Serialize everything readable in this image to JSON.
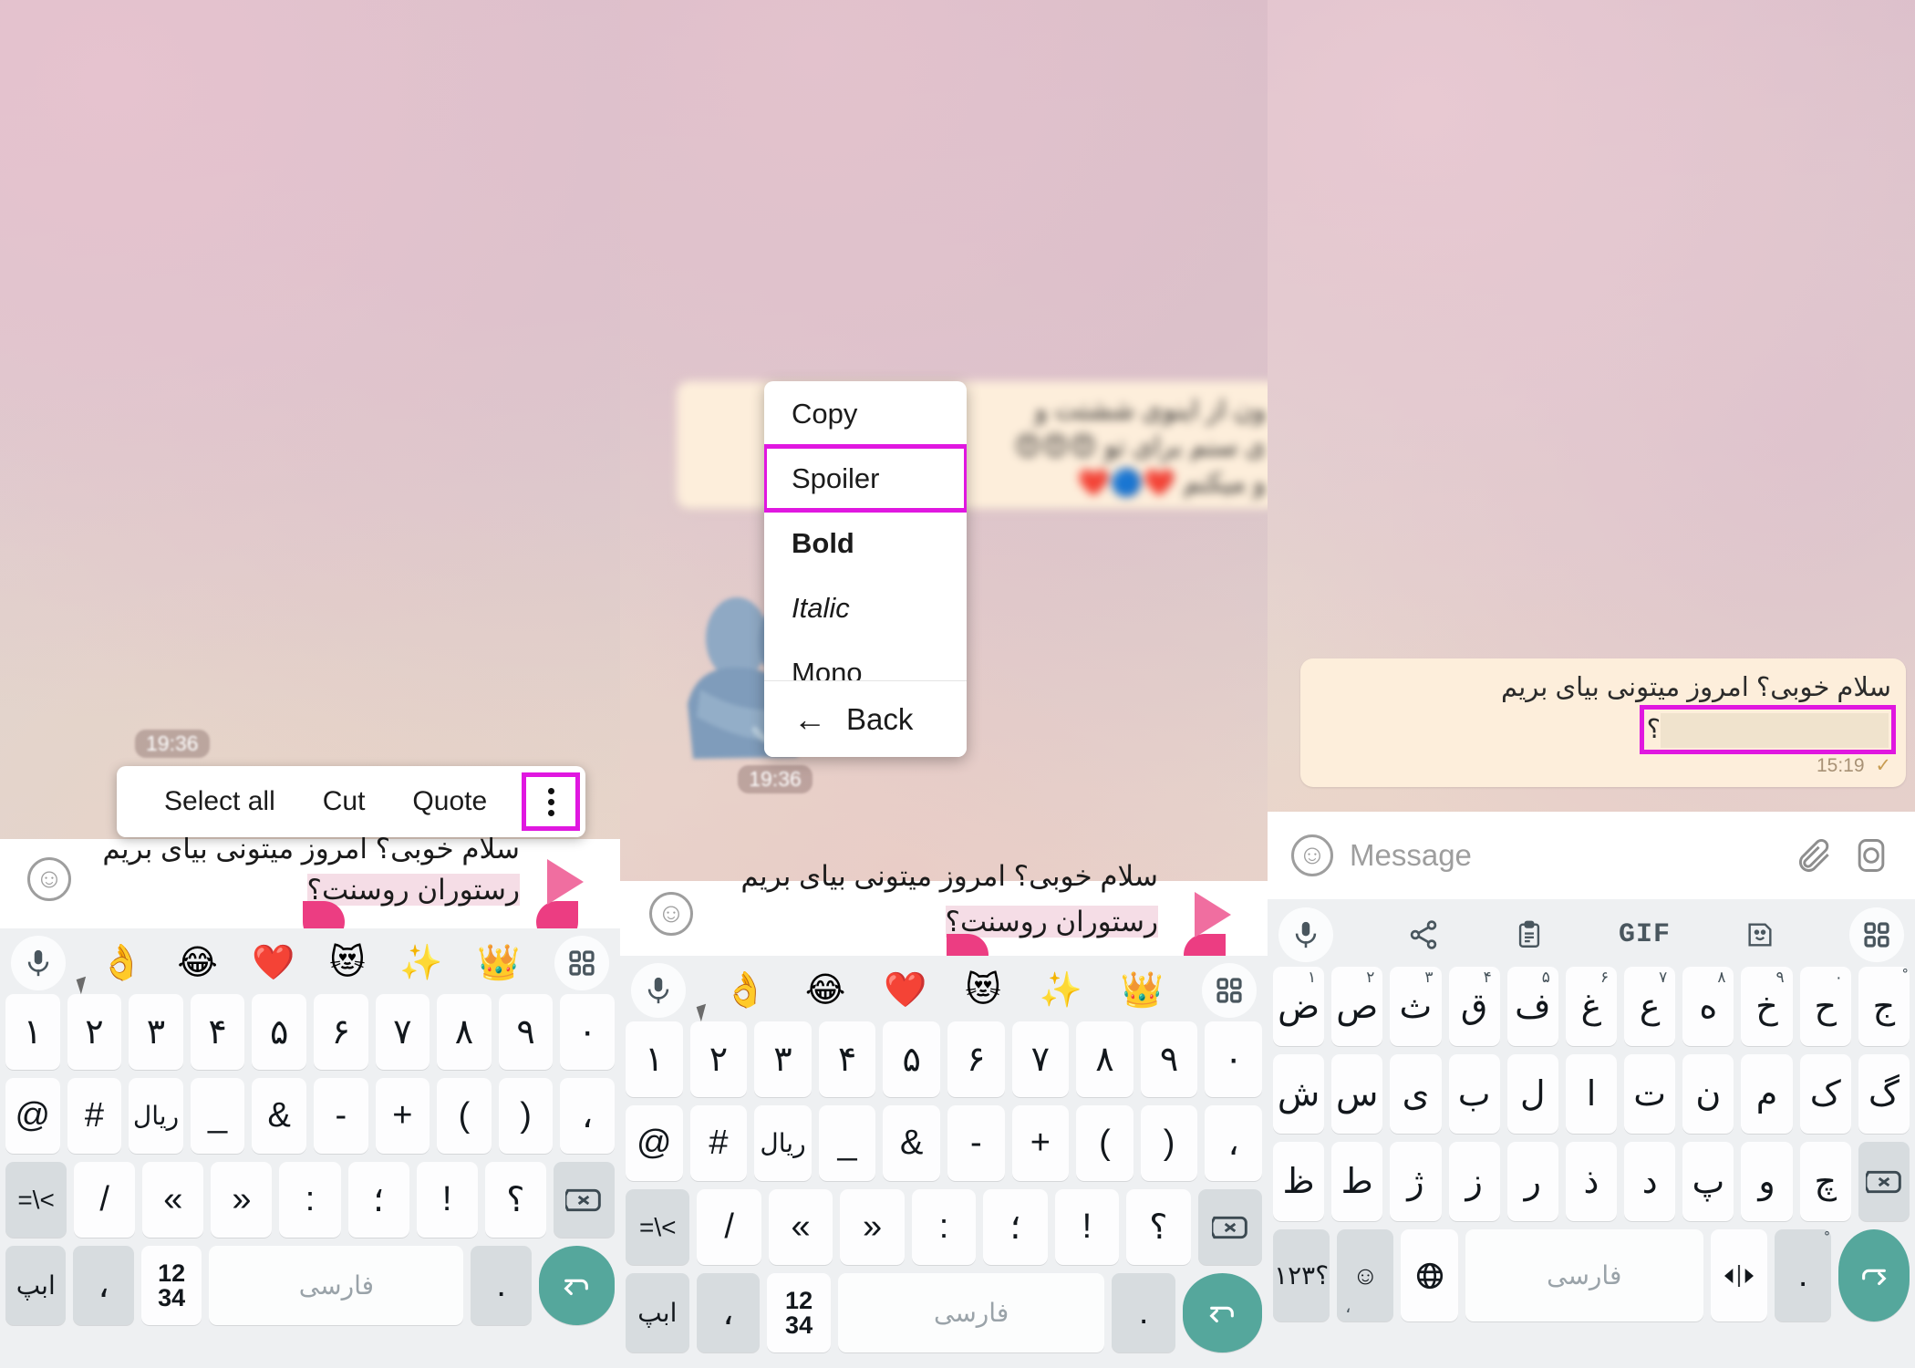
{
  "panels": {
    "left": {
      "timestamp": "19:36",
      "context_menu": {
        "items": [
          "Select all",
          "Cut",
          "Quote"
        ],
        "more_icon": "overflow-menu-icon"
      },
      "selected_message": {
        "line1": "سلام خوبی؟ امروز میتونی بیای بریم",
        "line2_plain": "رستوران روسنت؟",
        "highlighted": "رستوران روسنت؟"
      },
      "emoji_row": [
        "mic-icon",
        "👌",
        "😂",
        "❤️",
        "😻",
        "✨",
        "👑",
        "grid-icon"
      ],
      "keyboard": {
        "row1": [
          {
            "main": "۱"
          },
          {
            "main": "۲"
          },
          {
            "main": "۳"
          },
          {
            "main": "۴"
          },
          {
            "main": "۵"
          },
          {
            "main": "۶"
          },
          {
            "main": "۷"
          },
          {
            "main": "۸"
          },
          {
            "main": "۹"
          },
          {
            "main": "۰"
          }
        ],
        "row2": [
          {
            "main": "@"
          },
          {
            "main": "#"
          },
          {
            "main": "ریال"
          },
          {
            "main": "_"
          },
          {
            "main": "&"
          },
          {
            "main": "-"
          },
          {
            "main": "+"
          },
          {
            "main": "("
          },
          {
            "main": ")"
          },
          {
            "main": "،"
          }
        ],
        "row3": [
          {
            "main": "=\\<",
            "grey": true
          },
          {
            "main": "/"
          },
          {
            "main": "«"
          },
          {
            "main": "»"
          },
          {
            "main": ":"
          },
          {
            "main": "؛"
          },
          {
            "main": "!"
          },
          {
            "main": "؟"
          },
          {
            "main": "backspace-icon",
            "grey": true
          }
        ],
        "row4": [
          {
            "main": "ابپ",
            "grey": true
          },
          {
            "main": "،",
            "grey": true
          },
          {
            "main": "1234",
            "stack": true
          },
          {
            "main": "فارسی",
            "space": true
          },
          {
            "main": ".",
            "grey": true
          },
          {
            "main": "enter-icon",
            "enter": true
          }
        ]
      }
    },
    "middle": {
      "timestamp": "19:36",
      "blurred_bubble": {
        "line1": "ون از اینوی ششتت و",
        "line2": "ی سنم برای تو 😍😍😍",
        "line3": "و میکنم ❤️🔵❤️"
      },
      "sticker": {
        "name": "hug-sticker",
        "timestamp": "19:36"
      },
      "dropdown": {
        "items": [
          {
            "label": "Copy",
            "style": "normal",
            "selected": false
          },
          {
            "label": "Spoiler",
            "style": "normal",
            "selected": true
          },
          {
            "label": "Bold",
            "style": "bold",
            "selected": false
          },
          {
            "label": "Italic",
            "style": "italic",
            "selected": false
          },
          {
            "label": "Mono",
            "style": "normal",
            "selected": false
          }
        ],
        "back_label": "Back",
        "back_icon": "arrow-left-icon"
      },
      "selected_message": {
        "line1": "سلام خوبی؟ امروز میتونی بیای بریم",
        "line2_plain": "رستوران روسنت؟",
        "highlighted": "رستوران روسنت؟"
      },
      "emoji_row": [
        "mic-icon",
        "👌",
        "😂",
        "❤️",
        "😻",
        "✨",
        "👑",
        "grid-icon"
      ],
      "keyboard": {
        "row1": [
          {
            "main": "۱"
          },
          {
            "main": "۲"
          },
          {
            "main": "۳"
          },
          {
            "main": "۴"
          },
          {
            "main": "۵"
          },
          {
            "main": "۶"
          },
          {
            "main": "۷"
          },
          {
            "main": "۸"
          },
          {
            "main": "۹"
          },
          {
            "main": "۰"
          }
        ],
        "row2": [
          {
            "main": "@"
          },
          {
            "main": "#"
          },
          {
            "main": "ریال"
          },
          {
            "main": "_"
          },
          {
            "main": "&"
          },
          {
            "main": "-"
          },
          {
            "main": "+"
          },
          {
            "main": "("
          },
          {
            "main": ")"
          },
          {
            "main": "،"
          }
        ],
        "row3": [
          {
            "main": "=\\<",
            "grey": true
          },
          {
            "main": "/"
          },
          {
            "main": "«"
          },
          {
            "main": "»"
          },
          {
            "main": ":"
          },
          {
            "main": "؛"
          },
          {
            "main": "!"
          },
          {
            "main": "؟"
          },
          {
            "main": "backspace-icon",
            "grey": true
          }
        ],
        "row4": [
          {
            "main": "ابپ",
            "grey": true
          },
          {
            "main": "،",
            "grey": true
          },
          {
            "main": "1234",
            "stack": true
          },
          {
            "main": "فارسی",
            "space": true
          },
          {
            "main": ".",
            "grey": true
          },
          {
            "main": "enter-icon",
            "enter": true
          }
        ]
      }
    },
    "right": {
      "message": {
        "line1": "سلام خوبی؟ امروز میتونی بیای بریم",
        "spoiler_prefix": "؟",
        "spoiler_label": "hidden-spoiler-text",
        "time": "15:19",
        "status": "sent-check"
      },
      "input_bar": {
        "placeholder": "Message",
        "emoji_icon": "smiley-icon",
        "attach_icon": "paperclip-icon",
        "camera_icon": "camera-icon"
      },
      "toolbar": [
        "mic-icon",
        "share-icon",
        "clipboard-icon",
        "GIF",
        "sticker-icon",
        "grid-icon"
      ],
      "keyboard": {
        "row1": [
          {
            "main": "ض",
            "sup": "۱"
          },
          {
            "main": "ص",
            "sup": "۲"
          },
          {
            "main": "ث",
            "sup": "۳"
          },
          {
            "main": "ق",
            "sup": "۴"
          },
          {
            "main": "ف",
            "sup": "۵"
          },
          {
            "main": "غ",
            "sup": "۶"
          },
          {
            "main": "ع",
            "sup": "۷"
          },
          {
            "main": "ه",
            "sup": "۸"
          },
          {
            "main": "خ",
            "sup": "۹"
          },
          {
            "main": "ح",
            "sup": "۰"
          },
          {
            "main": "ج",
            "sup": "ْ"
          }
        ],
        "row2": [
          {
            "main": "ش"
          },
          {
            "main": "س"
          },
          {
            "main": "ی"
          },
          {
            "main": "ب"
          },
          {
            "main": "ل"
          },
          {
            "main": "ا"
          },
          {
            "main": "ت"
          },
          {
            "main": "ن"
          },
          {
            "main": "م"
          },
          {
            "main": "ک"
          },
          {
            "main": "گ"
          }
        ],
        "row3": [
          {
            "main": "ظ"
          },
          {
            "main": "ط"
          },
          {
            "main": "ژ"
          },
          {
            "main": "ز"
          },
          {
            "main": "ر"
          },
          {
            "main": "ذ"
          },
          {
            "main": "د"
          },
          {
            "main": "پ"
          },
          {
            "main": "و"
          },
          {
            "main": "چ"
          },
          {
            "main": "backspace-icon",
            "grey": true
          }
        ],
        "row4": [
          {
            "main": "۱۲۳؟",
            "grey": true
          },
          {
            "main": "emoji-icon",
            "grey": true,
            "sub": "،"
          },
          {
            "main": "globe-icon"
          },
          {
            "main": "فارسی",
            "space": true
          },
          {
            "main": "cursor-move-icon"
          },
          {
            "main": ".",
            "grey": true,
            "sup": "ْ"
          },
          {
            "main": "enter-icon",
            "enter": true
          }
        ]
      }
    }
  },
  "colors": {
    "accent_magenta": "#e017e0",
    "handle_pink": "#ec3d82",
    "bubble_cream": "#fdeedb",
    "enter_teal": "#55a79c"
  }
}
